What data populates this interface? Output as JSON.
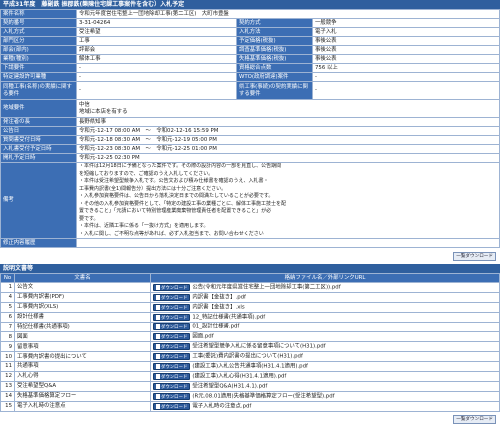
{
  "title": "平成31年度　藤副鉄 振郡鉄(樂陳住宅課工事案件を含む）入札予定",
  "info": [
    {
      "l1": "案件名称",
      "v1": "令和元年度営住宅整上一団地除却工事(第二工区)　大町市豊盤",
      "span": true
    },
    {
      "l1": "契約番号",
      "v1": "3-31-04264",
      "l2": "契約方式",
      "v2": "一般競争"
    },
    {
      "l1": "入札方式",
      "v1": "受注希望",
      "l2": "入札方法",
      "v2": "電子入札"
    },
    {
      "l1": "部門区分",
      "v1": "工事",
      "l2": "予定価格(税抜)",
      "v2": "事後公表"
    },
    {
      "l1": "部会(部内)",
      "v1": "評部会",
      "l2": "調査基準価格(税抜)",
      "v2": "事後公表"
    },
    {
      "l1": "業種(種別)",
      "v1": "解体工事",
      "l2": "失格基準価格(税抜)",
      "v2": "事後公表"
    },
    {
      "l1": "下請要件",
      "v1": "-",
      "l2": "資格総合点数",
      "v2": "756 以上"
    },
    {
      "l1": "特定建設許可業種",
      "v1": "-",
      "l2": "WTO(政府調達)案件",
      "v2": "-"
    },
    {
      "l1": "同種工事(名称)の実績に関する要件",
      "v1": "-",
      "l2": "県工事(事続)の契約実績に関する要件",
      "v2": "-",
      "tall": true
    },
    {
      "l1": "地域要件",
      "v1": "中信\n地域に本店を有する",
      "span": true,
      "tall": true
    },
    {
      "l1": "発注者の長",
      "v1": "長野県知事",
      "span": true
    },
    {
      "l1": "公告日",
      "v1": "令和元-12-17 08:00 AM　～　令和02-12-16 15:59 PM",
      "span": true
    },
    {
      "l1": "質問書受付日時",
      "v1": "令和元-12-18 08:30 AM　～　令和元-12-19 05:00 PM",
      "span": true
    },
    {
      "l1": "入札書受付予定日時",
      "v1": "令和元-12-23 08:30 AM　～　令和元-12-25 01:00 PM",
      "span": true
    },
    {
      "l1": "開札予定日時",
      "v1": "令和元-12-25 02:30 PM",
      "span": true
    }
  ],
  "remarks_label": "備考",
  "remarks": [
    "・本件は12月18日に予備となった案件です。その際の設計内容の一部を見直し、公告期間",
    "を短縮しておりますので、ご確認のうえ入札してください。",
    "・本件は受注希望型競争入札です。公告文および積み仕様書を確認のうえ、入札書・",
    "工事費内訳書(全1)間報告分）提出方法には十分ご注意ください。",
    "・入札参加資格要件は、公告日から落札決定日までの間満たしていることが必要です。",
    "・その他の入札参加資格要件として、「特定の建設工事の業種ごとに、解体工事施工技士を配",
    "置できること」「元請において特別管理産業廃棄物管理責任者を配置できること」が必",
    "要です。",
    "・本件は、近隣工事に係る「一抜け方式」を適用します。",
    "・入札に関し、ご不明な点等があれば、必ず入札担当まで、お問い合わせください"
  ],
  "amend_label": "修正内容履歴",
  "list_button": "一覧ダウンロード",
  "docs_title": "説明文書等",
  "docs_headers": {
    "no": "No",
    "name": "文書名",
    "file": "格納ファイル名／外部リンクURL"
  },
  "download_label": "ダウンロード",
  "docs": [
    {
      "no": "1",
      "name": "公告文",
      "file": "公告(令和元年度県営住宅整上一団地除却工事(第二工区)).pdf"
    },
    {
      "no": "4",
      "name": "工事費内訳書(PDF)",
      "file": "内訳書【金抜き】.pdf"
    },
    {
      "no": "5",
      "name": "工事費内訳(XLS)",
      "file": "内訳書【金抜き】.xls"
    },
    {
      "no": "6",
      "name": "設計仕様書",
      "file": "12_特記仕様書(共通事項).pdf"
    },
    {
      "no": "7",
      "name": "特記仕様書(共通事項)",
      "file": "01_設計仕様書.pdf"
    },
    {
      "no": "8",
      "name": "図面",
      "file": "図面.pdf"
    },
    {
      "no": "9",
      "name": "留意事項",
      "file": "受注希望型競争入札に係る留意事項について(H31).pdf"
    },
    {
      "no": "10",
      "name": "工事費内訳書の提出について",
      "file": "工事(委託)費内訳書の提出について(H31).pdf"
    },
    {
      "no": "11",
      "name": "共通事項",
      "file": "(建設工事)入札公告共通事項(H31.4.1適用).pdf"
    },
    {
      "no": "12",
      "name": "入札心得",
      "file": "(建設工事)入札心得(H31.4.1適用).pdf"
    },
    {
      "no": "13",
      "name": "受注希望型Q&A",
      "file": "受注希望型Q&A(H31.4.1).pdf"
    },
    {
      "no": "14",
      "name": "失格基準価格算定フロー",
      "file": "(R元.08.01適用)失格基準価格算定フロー(受注希望型).pdf"
    },
    {
      "no": "15",
      "name": "電子入札時の注意点",
      "file": "電子入札時の注意点.pdf"
    }
  ]
}
